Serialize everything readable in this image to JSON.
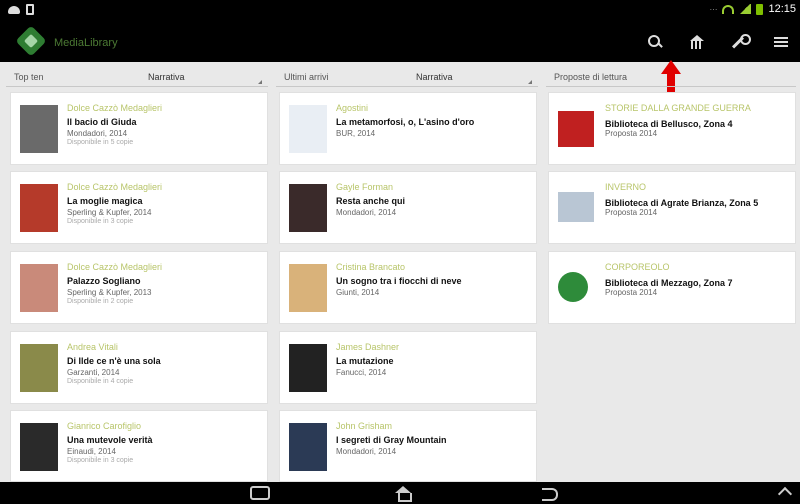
{
  "statusbar": {
    "time": "12:15"
  },
  "app": {
    "title": "MediaLibrary"
  },
  "columns": [
    {
      "label": "Top ten",
      "filter": "Narrativa"
    },
    {
      "label": "Ultimi arrivi",
      "filter": "Narrativa"
    },
    {
      "label": "Proposte di lettura",
      "filter": ""
    }
  ],
  "top_ten": [
    {
      "author": "Dolce Cazzò Medaglieri",
      "title": "Il bacio di Giuda",
      "publisher": "Mondadori, 2014",
      "meta": "Disponibile in 5 copie",
      "cover_color": "#6a6a6a"
    },
    {
      "author": "Dolce Cazzò Medaglieri",
      "title": "La moglie magica",
      "publisher": "Sperling & Kupfer, 2014",
      "meta": "Disponibile in 3 copie",
      "cover_color": "#b53a2a"
    },
    {
      "author": "Dolce Cazzò Medaglieri",
      "title": "Palazzo Sogliano",
      "publisher": "Sperling & Kupfer, 2013",
      "meta": "Disponibile in 2 copie",
      "cover_color": "#c98a7a"
    },
    {
      "author": "Andrea Vitali",
      "title": "Di Ilde ce n'è una sola",
      "publisher": "Garzanti, 2014",
      "meta": "Disponibile in 4 copie",
      "cover_color": "#8a8a4a"
    },
    {
      "author": "Gianrico Carofiglio",
      "title": "Una mutevole verità",
      "publisher": "Einaudi, 2014",
      "meta": "Disponibile in 3 copie",
      "cover_color": "#2a2a2a"
    }
  ],
  "ultimi_arrivi": [
    {
      "author": "Agostini",
      "title": "La metamorfosi, o, L'asino d'oro",
      "publisher": "BUR, 2014",
      "meta": "",
      "cover_color": "#e9eef4"
    },
    {
      "author": "Gayle Forman",
      "title": "Resta anche qui",
      "publisher": "Mondadori, 2014",
      "meta": "",
      "cover_color": "#3a2a2a"
    },
    {
      "author": "Cristina Brancato",
      "title": "Un sogno tra i fiocchi di neve",
      "publisher": "Giunti, 2014",
      "meta": "",
      "cover_color": "#d9b27a"
    },
    {
      "author": "James Dashner",
      "title": "La mutazione",
      "publisher": "Fanucci, 2014",
      "meta": "",
      "cover_color": "#222222"
    },
    {
      "author": "John Grisham",
      "title": "I segreti di Gray Mountain",
      "publisher": "Mondadori, 2014",
      "meta": "",
      "cover_color": "#2b3a55"
    }
  ],
  "proposte": [
    {
      "author": "STORIE DALLA GRANDE GUERRA",
      "title": "Biblioteca di Bellusco, Zona 4",
      "meta": "Proposta 2014",
      "cover_color": "#c02020"
    },
    {
      "author": "INVERNO",
      "title": "Biblioteca di Agrate Brianza, Zona 5",
      "meta": "Proposta 2014",
      "cover_color": "#b9c6d4"
    },
    {
      "author": "CORPOREOLO",
      "title": "Biblioteca di Mezzago, Zona 7",
      "meta": "Proposta 2014",
      "cover_color": "#2e8b3a"
    }
  ]
}
